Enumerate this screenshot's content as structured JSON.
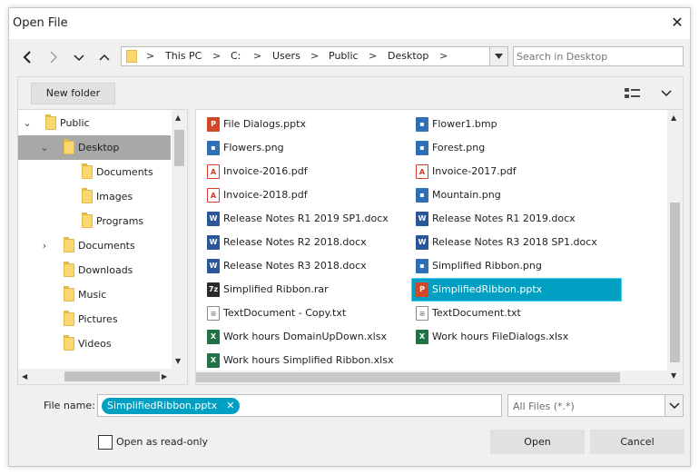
{
  "window": {
    "title": "Open File"
  },
  "address": {
    "segments": [
      "This PC",
      "C:",
      "Users",
      "Public",
      "Desktop"
    ]
  },
  "search": {
    "placeholder": "Search in Desktop"
  },
  "toolbar": {
    "new_folder_label": "New folder"
  },
  "tree": {
    "items": [
      {
        "label": "Public",
        "expanded": true
      },
      {
        "label": "Desktop",
        "expanded": true,
        "selected": true
      },
      {
        "label": "Documents"
      },
      {
        "label": "Images"
      },
      {
        "label": "Programs"
      },
      {
        "label": "Documents",
        "collapsed": true
      },
      {
        "label": "Downloads"
      },
      {
        "label": "Music"
      },
      {
        "label": "Pictures"
      },
      {
        "label": "Videos"
      }
    ]
  },
  "files": {
    "items": [
      {
        "name": "File Dialogs.pptx",
        "type": "pptx"
      },
      {
        "name": "Flower1.bmp",
        "type": "image"
      },
      {
        "name": "Flowers.png",
        "type": "image"
      },
      {
        "name": "Forest.png",
        "type": "image"
      },
      {
        "name": "Invoice-2016.pdf",
        "type": "pdf"
      },
      {
        "name": "Invoice-2017.pdf",
        "type": "pdf"
      },
      {
        "name": "Invoice-2018.pdf",
        "type": "pdf"
      },
      {
        "name": "Mountain.png",
        "type": "image"
      },
      {
        "name": "Release Notes R1 2019 SP1.docx",
        "type": "docx"
      },
      {
        "name": "Release Notes R1 2019.docx",
        "type": "docx"
      },
      {
        "name": "Release Notes R2 2018.docx",
        "type": "docx"
      },
      {
        "name": "Release Notes R3 2018 SP1.docx",
        "type": "docx"
      },
      {
        "name": "Release Notes R3 2018.docx",
        "type": "docx"
      },
      {
        "name": "Simplified Ribbon.png",
        "type": "image"
      },
      {
        "name": "Simplified Ribbon.rar",
        "type": "rar"
      },
      {
        "name": "SimplifiedRibbon.pptx",
        "type": "pptx",
        "selected": true
      },
      {
        "name": "TextDocument - Copy.txt",
        "type": "txt"
      },
      {
        "name": "TextDocument.txt",
        "type": "txt"
      },
      {
        "name": "Work hours DomainUpDown.xlsx",
        "type": "xlsx"
      },
      {
        "name": "Work hours FileDialogs.xlsx",
        "type": "xlsx"
      },
      {
        "name": "Work hours Simplified Ribbon.xlsx",
        "type": "xlsx"
      }
    ]
  },
  "bottom": {
    "file_name_label": "File name:",
    "file_name_token": "SimplifiedRibbon.pptx",
    "filter_value": "All Files (*.*)",
    "read_only_label": "Open as read-only",
    "read_only_checked": false,
    "open_label": "Open",
    "cancel_label": "Cancel"
  },
  "colors": {
    "accent": "#019fc1",
    "pptx": "#d24726",
    "pdf": "#d9382b",
    "docx": "#2b579a",
    "xlsx": "#217346",
    "image": "#2f6fb5",
    "folder": "#fbd76f"
  }
}
